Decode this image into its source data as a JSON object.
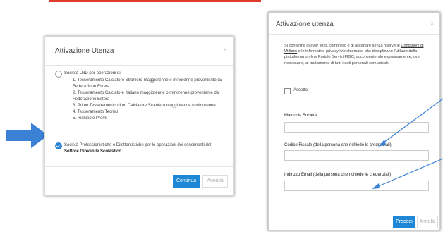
{
  "left_dialog": {
    "title": "Attivazione Utenza",
    "close": "×",
    "option1_label_prefix": "Società LND",
    "option1_label_rest": " per operazioni di:",
    "option1_items": [
      "1. Tesseramento Calciatore Straniero maggiorenne o minorenne proveniente da Federazione Estera",
      "2. Tesseramento Calciatore Italiano maggiorenne o minorenne proveniente da Federazione Estera",
      "3. Primo Tesseramento di un Calciatore Straniero maggiorenne o minorenne",
      "4. Tesseramento Tecnici",
      "5. Richieste Premi"
    ],
    "option2_text": "Società Professionistiche e Dilettantistiche per le operazioni dei censimenti del ",
    "option2_bold": "Settore Giovanile Scolastico",
    "continue_button": "Continua",
    "cancel_button": "Annulla"
  },
  "right_dialog": {
    "title": "Attivazione utenza",
    "close": "×",
    "para_start": "Si conferma di aver letto, compreso e di accettare senza riserve le ",
    "para_link": "Condizioni di Utilizzo",
    "para_end": " e le informative privacy ivi richiamate, che disciplinano l'utilizzo della piattaforma on-line Portale Servizi FIGC, acconsentendo espressamente, ove necessario, al trattamento di tutti i dati personali comunicati.",
    "accept_label": "Accetto",
    "field1_label": "Matricola Società",
    "field2_label": "Codice Fiscale (della persona che richiede le credenziali)",
    "field3_label": "Indirizzo Email (della persona che richiede le credenziali)",
    "proceed_button": "Procedi",
    "cancel_button": "Annulla"
  },
  "colors": {
    "accent": "#1e88d6",
    "arrow": "#3b82d6",
    "banner": "#e03a2a"
  }
}
